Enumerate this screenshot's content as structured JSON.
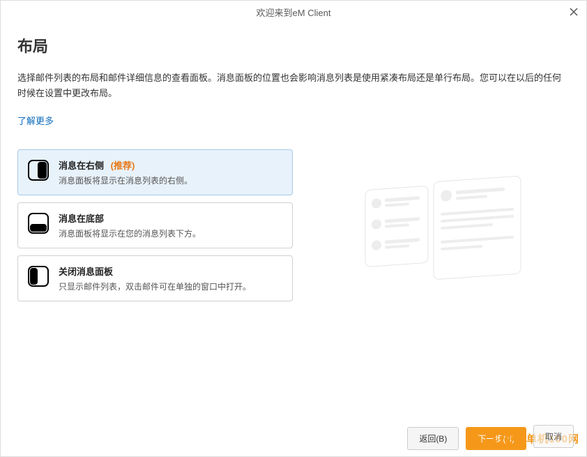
{
  "window": {
    "title": "欢迎来到eM Client"
  },
  "page": {
    "heading": "布局",
    "description": "选择邮件列表的布局和邮件详细信息的查看面板。消息面板的位置也会影响消息列表是使用紧凑布局还是单行布局。您可以在以后的任何时候在设置中更改布局。",
    "learn_more": "了解更多"
  },
  "options": [
    {
      "title": "消息在右侧",
      "recommended": "(推荐)",
      "desc": "消息面板将显示在消息列表的右侧。",
      "selected": true,
      "icon": "layout-right-icon"
    },
    {
      "title": "消息在底部",
      "recommended": "",
      "desc": "消息面板将显示在您的消息列表下方。",
      "selected": false,
      "icon": "layout-bottom-icon"
    },
    {
      "title": "关闭消息面板",
      "recommended": "",
      "desc": "只显示邮件列表，双击邮件可在单独的窗口中打开。",
      "selected": false,
      "icon": "layout-off-icon"
    }
  ],
  "footer": {
    "back": "返回(B)",
    "next": "下一步(N)",
    "cancel": "取消"
  },
  "watermark": {
    "text": "单机100网"
  }
}
